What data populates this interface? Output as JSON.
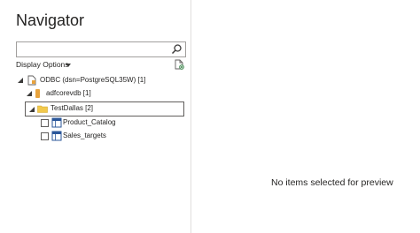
{
  "navigator": {
    "title": "Navigator",
    "search": {
      "value": "",
      "placeholder": ""
    },
    "display_options_label": "Display Options",
    "icons": {
      "search": "search-icon",
      "new_query": "new-query-icon",
      "expand": "expanded-triangle-icon"
    },
    "tree": {
      "root": {
        "label": "ODBC (dsn=PostgreSQL35W) [1]",
        "icon": "odbc-source-icon"
      },
      "database": {
        "label": "adfcorevdb [1]",
        "icon": "database-icon"
      },
      "schema": {
        "label": "TestDallas [2]",
        "icon": "folder-icon"
      },
      "tables": [
        {
          "label": "Product_Catalog",
          "icon": "table-icon",
          "checked": false
        },
        {
          "label": "Sales_targets",
          "icon": "table-icon",
          "checked": false
        }
      ]
    }
  },
  "preview": {
    "message": "No items selected for preview"
  },
  "colors": {
    "folder": "#f2c94c",
    "database": "#e8a33d",
    "table_blue": "#2b579a",
    "border": "#a19f9d",
    "selection_border": "#605e5c"
  }
}
